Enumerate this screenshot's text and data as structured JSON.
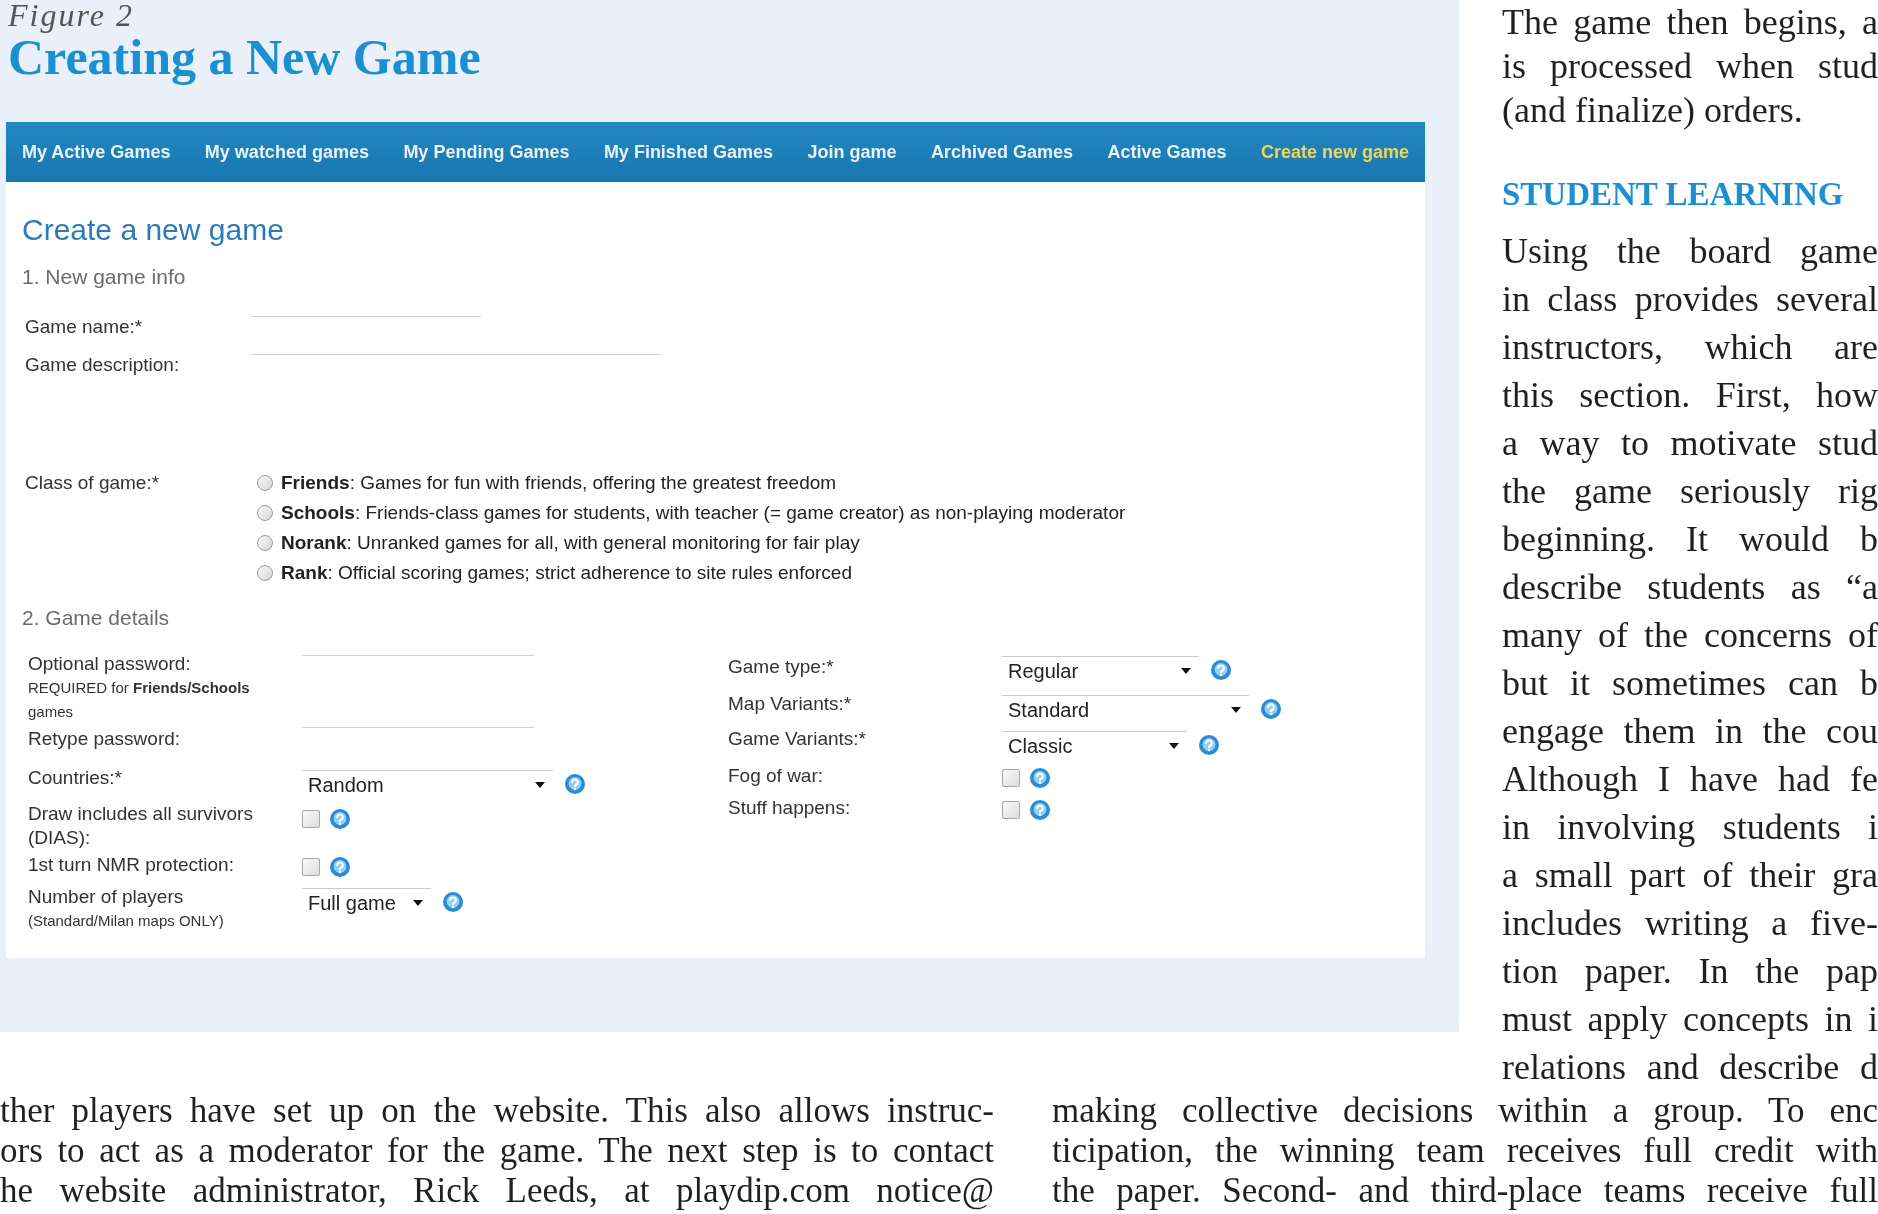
{
  "figure": {
    "label": "Figure 2",
    "title": "Creating a New Game",
    "nav_tabs": [
      {
        "label": "My Active Games",
        "selected": false
      },
      {
        "label": "My watched games",
        "selected": false
      },
      {
        "label": "My Pending Games",
        "selected": false
      },
      {
        "label": "My Finished Games",
        "selected": false
      },
      {
        "label": "Join game",
        "selected": false
      },
      {
        "label": "Archived Games",
        "selected": false
      },
      {
        "label": "Active Games",
        "selected": false
      },
      {
        "label": "Create new game",
        "selected": true
      }
    ],
    "form": {
      "heading": "Create a new game",
      "new_game_info": {
        "title": "1. New game info",
        "fields": [
          {
            "kind": "text",
            "label": "Game name:*"
          },
          {
            "kind": "textarea",
            "label": "Game description:"
          }
        ],
        "class_of_game": {
          "label": "Class of game:*",
          "options": [
            {
              "text": "**Friends**: Games for fun with friends, offering the greatest freedom",
              "selected": false
            },
            {
              "text": "**Schools**: Friends-class games for students, with teacher (= game creator) as non-playing moderator",
              "selected": false
            },
            {
              "text": "**Norank**: Unranked games for all, with general monitoring for fair play",
              "selected": false
            },
            {
              "text": "**Rank**: Official scoring games; strict adherence to site rules enforced",
              "selected": false
            }
          ]
        }
      },
      "game_details": {
        "title": "2. Game details",
        "left_rows": [
          {
            "kind": "password",
            "label": "Optional password:",
            "note": "REQUIRED for **Friends/Schools** games"
          },
          {
            "kind": "password",
            "label": "Retype password:"
          },
          {
            "kind": "select",
            "label": "Countries:*",
            "value": "Random"
          },
          {
            "kind": "checkbox",
            "label": "Draw includes all survivors (DIAS):",
            "checked": false
          },
          {
            "kind": "checkbox",
            "label": "1st turn NMR protection:",
            "checked": false
          },
          {
            "kind": "select",
            "label": "Number of players",
            "note": "(Standard/Milan maps ONLY)",
            "value": "Full game"
          }
        ],
        "right_rows": [
          {
            "kind": "select",
            "label": "Game type:*",
            "value": "Regular"
          },
          {
            "kind": "select",
            "label": "Map Variants:*",
            "value": "Standard"
          },
          {
            "kind": "select",
            "label": "Game Variants:*",
            "value": "Classic"
          },
          {
            "kind": "checkbox",
            "label": "Fog of war:",
            "checked": false
          },
          {
            "kind": "checkbox",
            "label": "Stuff happens:",
            "checked": false
          }
        ]
      }
    }
  },
  "side_column": [
    {
      "kind": "paragraph",
      "lines": [
        "The game then begins, a",
        "is processed when stud",
        "(and finalize) orders."
      ]
    },
    {
      "kind": "heading",
      "text": "STUDENT LEARNING"
    },
    {
      "kind": "paragraph",
      "lines": [
        "Using the board game",
        "in class provides several",
        "instructors, which are",
        "this section. First, how",
        "a way to motivate stud",
        "the game seriously rig",
        "beginning. It would b",
        "describe students as “a",
        "many of the concerns of",
        "but it sometimes can b",
        "engage them in the cou",
        "Although I have had fe",
        "in involving students i",
        "a small part of their gra",
        "includes writing a five-",
        "tion paper. In the pap",
        "must apply concepts in i",
        "relations and describe d"
      ]
    }
  ],
  "lower_columns": [
    {
      "lines": [
        "ther players have set up on the website. This also allows instruc-",
        "ors to act as a moderator for the game. The next step is to contact",
        "he website administrator, Rick Leeds, at playdip.com notice@"
      ]
    },
    {
      "lines": [
        "making collective decisions within a group. To enc",
        "ticipation, the winning team receives full credit with",
        "the paper. Second- and third-place teams receive full"
      ]
    }
  ]
}
